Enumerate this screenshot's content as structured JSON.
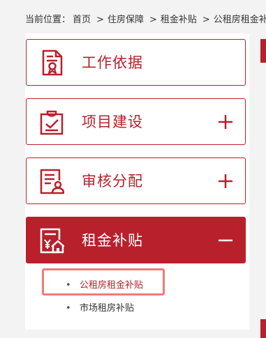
{
  "breadcrumb": {
    "prefix": "当前位置：",
    "items": [
      "首页",
      "住房保障",
      "租金补贴",
      "公租房租金补贴"
    ],
    "separator": ">"
  },
  "menu": [
    {
      "label": "工作依据",
      "icon": "document-certificate-icon",
      "toggle": "none"
    },
    {
      "label": "项目建设",
      "icon": "clipboard-check-icon",
      "toggle": "plus-icon"
    },
    {
      "label": "审核分配",
      "icon": "form-user-icon",
      "toggle": "plus-icon"
    },
    {
      "label": "租金补贴",
      "icon": "house-subsidy-icon",
      "toggle": "minus-icon"
    }
  ],
  "submenu": [
    {
      "bullet": "•",
      "label": "公租房租金补贴",
      "current": true
    },
    {
      "bullet": "•",
      "label": "市场租房补贴",
      "current": false
    }
  ],
  "colors": {
    "accent": "#b8202b",
    "highlight": "#f07a7a"
  }
}
